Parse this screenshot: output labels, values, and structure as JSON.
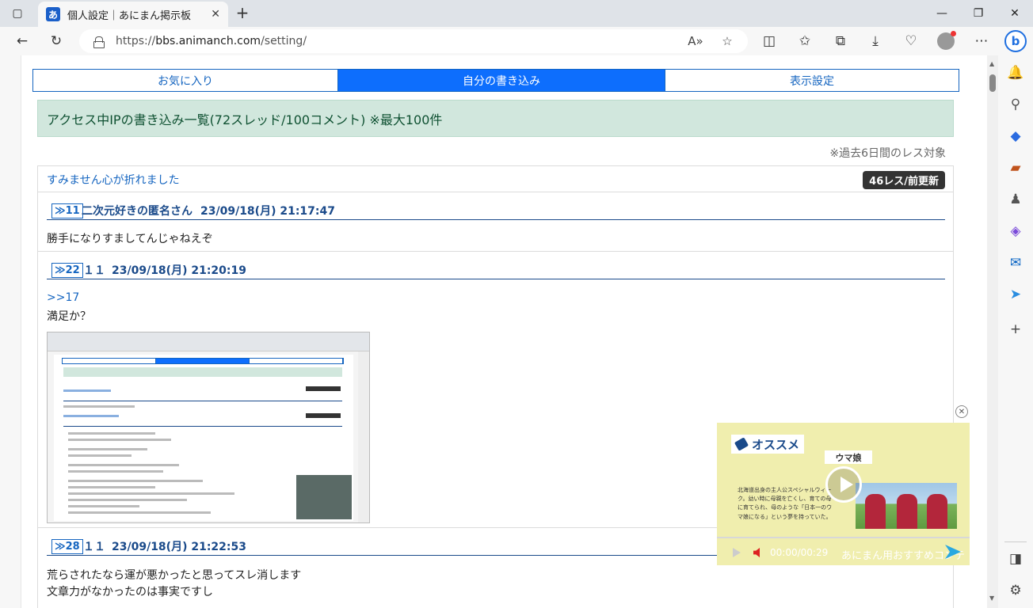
{
  "browser": {
    "tab_title": "個人設定｜あにまん掲示板",
    "favicon_char": "あ",
    "url_prefix": "https://",
    "url_host": "bbs.animanch.com",
    "url_path": "/setting/"
  },
  "nav": {
    "tabs": [
      {
        "label": "お気に入り",
        "active": false
      },
      {
        "label": "自分の書き込み",
        "active": true
      },
      {
        "label": "表示設定",
        "active": false
      }
    ]
  },
  "summary": "アクセス中IPの書き込み一覧(72スレッド/100コメント) ※最大100件",
  "note": "※過去6日間のレス対象",
  "thread": {
    "title": "すみません心が折れました",
    "badge": "46レス/前更新",
    "posts": [
      {
        "num": "≫11",
        "author": "二次元好きの匿名さん",
        "date": "23/09/18(月) 21:17:47",
        "lines": [
          "勝手になりすましてんじゃねえぞ"
        ]
      },
      {
        "num": "≫22",
        "author": "１１",
        "date": "23/09/18(月) 21:20:19",
        "anchor": ">>17",
        "lines": [
          "満足か？"
        ]
      },
      {
        "num": "≫28",
        "author": "１１",
        "date": "23/09/18(月) 21:22:53",
        "lines": [
          "荒らされたなら運が悪かったと思ってスレ消します",
          "文章力がなかったのは事実ですし"
        ]
      }
    ]
  },
  "ad": {
    "label": "オススメ",
    "brand": "ウマ娘",
    "desc": "北海道出身の主人公スペシャルウィーク。幼い時に母親を亡くし、育ての母に育てられ、母のような「日本一のウマ娘になる」という夢を持っていた。",
    "time": "00:00/00:29",
    "caption": "あにまん用おすすめコンテ"
  },
  "colors": {
    "accent": "#0d6efd",
    "link": "#1565c0",
    "alert_bg": "#d1e7dd"
  }
}
